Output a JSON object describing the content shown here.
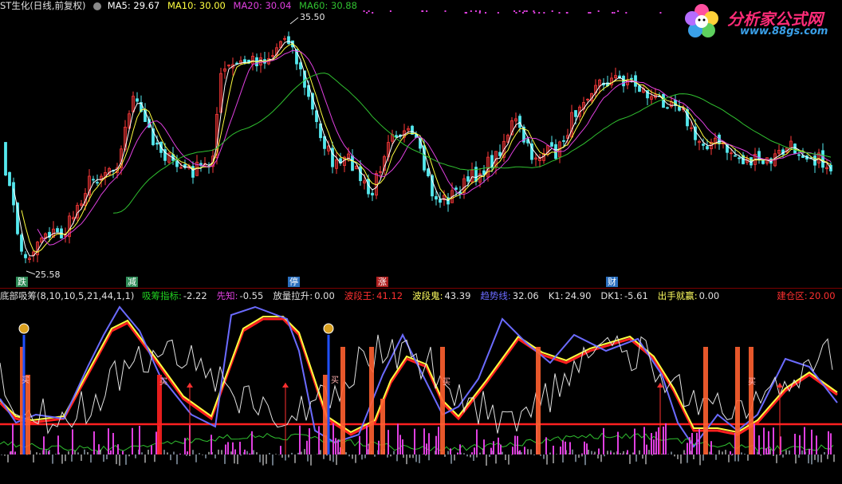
{
  "top_header": {
    "stock_label": "ST生化(日线,前复权)",
    "ma5": "MA5: 29.67",
    "ma10": "MA10: 30.00",
    "ma20": "MA20: 30.04",
    "ma60": "MA60: 30.88"
  },
  "price_labels": {
    "high": "35.50",
    "low": "25.58"
  },
  "event_labels": [
    {
      "text": "跌",
      "color": "#2e8b57"
    },
    {
      "text": "减",
      "color": "#2e8b57"
    },
    {
      "text": "停",
      "color": "#2a6fbf"
    },
    {
      "text": "涨",
      "color": "#b02020"
    },
    {
      "text": "财",
      "color": "#2a6fbf"
    }
  ],
  "indicator_header": {
    "name": "底部吸筹(8,10,10,5,21,44,1,1)",
    "items": [
      {
        "label": "吸筹指标:",
        "value": "-2.22",
        "color": "#20d020"
      },
      {
        "label": "先知:",
        "value": "-0.55",
        "color": "#e040e0"
      },
      {
        "label": "放量拉升:",
        "value": "0.00",
        "color": "#e0e0e0"
      },
      {
        "label": "波段王:",
        "value": "41.12",
        "color": "#ff3030"
      },
      {
        "label": "波段鬼:",
        "value": "43.39",
        "color": "#ffff60"
      },
      {
        "label": "趋势线:",
        "value": "32.06",
        "color": "#6b6bff"
      },
      {
        "label": "K1:",
        "value": "24.90",
        "color": "#e0e0e0"
      },
      {
        "label": "DK1:",
        "value": "-5.61",
        "color": "#e0e0e0"
      },
      {
        "label": "出手就赢:",
        "value": "0.00",
        "color": "#ffff60"
      },
      {
        "label": "建仓区:",
        "value": "20.00",
        "color": "#ff3030"
      }
    ]
  },
  "buy_tags": [
    "买",
    "买",
    "买",
    "买",
    "买"
  ],
  "logo": {
    "title": "分析家公式网",
    "url": "www.88gs.com"
  },
  "colors": {
    "bg": "#000000",
    "up_candle": "#ff3a3a",
    "down_candle": "#55e8ee",
    "ma5": "#ffffff",
    "ma10": "#ffff40",
    "ma20": "#e040e0",
    "ma60": "#30c030"
  }
}
